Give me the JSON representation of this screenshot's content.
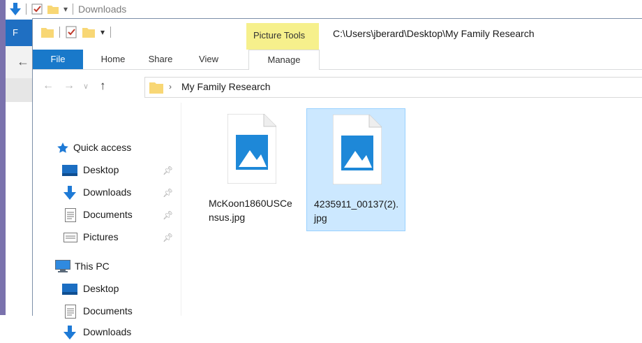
{
  "background_window": {
    "title": "Downloads",
    "file_tab_initial": "F"
  },
  "window": {
    "title": "C:\\Users\\jberard\\Desktop\\My Family Research",
    "context_tab_header": "Picture Tools"
  },
  "ribbon": {
    "tabs": [
      {
        "label": "File"
      },
      {
        "label": "Home"
      },
      {
        "label": "Share"
      },
      {
        "label": "View"
      },
      {
        "label": "Manage"
      }
    ]
  },
  "address_bar": {
    "path": "My Family Research"
  },
  "navigation": {
    "quick_access": "Quick access",
    "quick_items": [
      {
        "label": "Desktop",
        "icon": "desktop-icon"
      },
      {
        "label": "Downloads",
        "icon": "downloads-icon"
      },
      {
        "label": "Documents",
        "icon": "documents-icon"
      },
      {
        "label": "Pictures",
        "icon": "pictures-icon"
      }
    ],
    "this_pc": "This PC",
    "pc_items": [
      {
        "label": "Desktop",
        "icon": "desktop-icon"
      },
      {
        "label": "Documents",
        "icon": "documents-icon"
      },
      {
        "label": "Downloads",
        "icon": "downloads-icon"
      }
    ]
  },
  "files": [
    {
      "name": "McKoon1860USCensus.jpg",
      "selected": false,
      "icon": "image-file-icon"
    },
    {
      "name": "4235911_00137(2).jpg",
      "selected": true,
      "icon": "image-file-icon"
    }
  ],
  "colors": {
    "file_tab": "#1979ca",
    "picture_tools": "#f6f08c",
    "selection": "#cce8ff",
    "selection_border": "#99d1ff",
    "folder": "#f8d775",
    "image_icon": "#1e88d8"
  }
}
